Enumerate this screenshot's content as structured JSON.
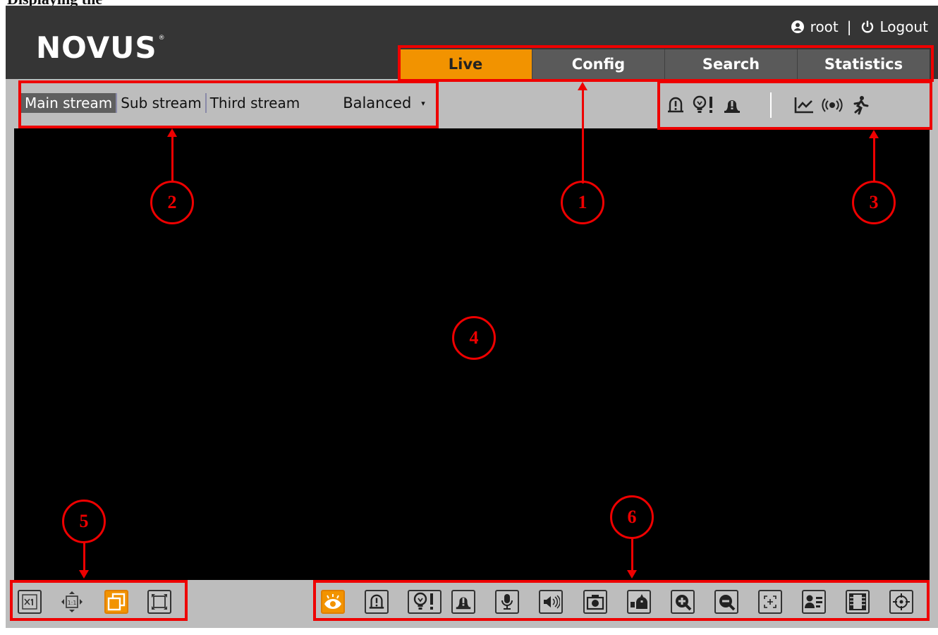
{
  "caption": "Displaying the",
  "header": {
    "logo_text": "NOVUS",
    "logo_mark": "®",
    "user": "root",
    "separator": "|",
    "logout_label": "Logout"
  },
  "tabs": [
    {
      "label": "Live",
      "active": true
    },
    {
      "label": "Config",
      "active": false
    },
    {
      "label": "Search",
      "active": false
    },
    {
      "label": "Statistics",
      "active": false
    }
  ],
  "streams": [
    {
      "label": "Main stream",
      "active": true
    },
    {
      "label": "Sub stream",
      "active": false
    },
    {
      "label": "Third stream",
      "active": false
    }
  ],
  "quality": {
    "value": "Balanced",
    "caret": "▾"
  },
  "alarm_icons": [
    "alarm-input-icon",
    "light-alarm-icon",
    "bell-alarm-icon",
    "line-chart-icon",
    "audio-wave-icon",
    "running-person-icon"
  ],
  "view_controls": [
    "original-scale-icon",
    "fit-1-1-icon",
    "window-overlap-icon",
    "fullscreen-icon"
  ],
  "view_controls_active": "window-overlap-icon",
  "actions": [
    "live-view-eye-icon",
    "alarm-output-icon",
    "light-alarm-icon",
    "bell-alarm-icon",
    "microphone-icon",
    "speaker-icon",
    "snapshot-camera-icon",
    "recording-icon",
    "zoom-in-icon",
    "zoom-out-icon",
    "digital-zoom-icon",
    "face-id-icon",
    "film-strip-icon",
    "crosshair-icon"
  ],
  "actions_active": "live-view-eye-icon",
  "callouts": [
    "1",
    "2",
    "3",
    "4",
    "5",
    "6"
  ],
  "colors": {
    "accent": "#f29300",
    "header": "#353535",
    "toolbar": "#bdbdbd",
    "annotation": "#ee0000"
  }
}
